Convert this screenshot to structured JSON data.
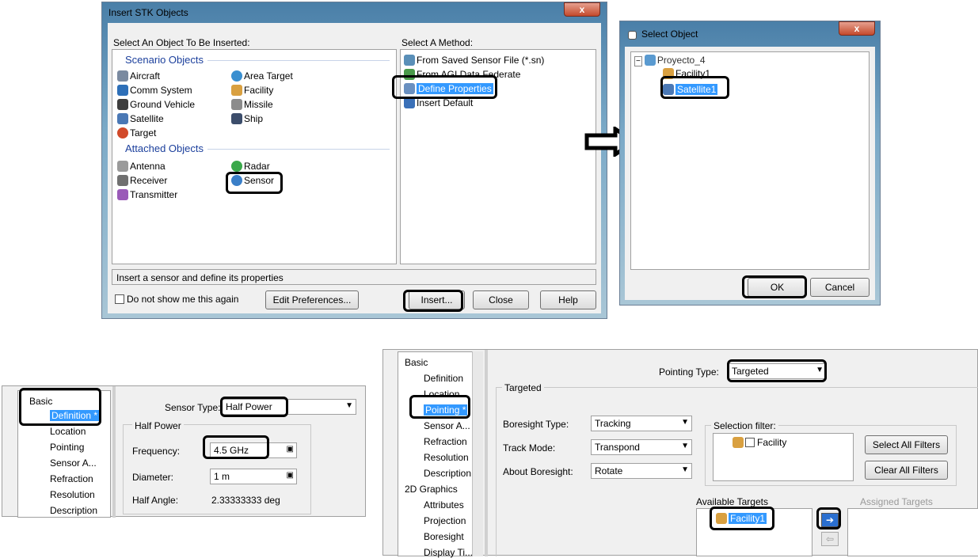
{
  "insert_dialog": {
    "title": "Insert STK Objects",
    "close": "x",
    "left_header": "Select An Object To Be Inserted:",
    "right_header": "Select A Method:",
    "scenario_header": "Scenario Objects",
    "attached_header": "Attached Objects",
    "scenario_objects": [
      "Aircraft",
      "Area Target",
      "Comm System",
      "Facility",
      "Ground Vehicle",
      "Missile",
      "Satellite",
      "Ship",
      "Target"
    ],
    "attached_objects": [
      "Antenna",
      "Radar",
      "Receiver",
      "Sensor",
      "Transmitter"
    ],
    "methods": [
      "From Saved Sensor File (*.sn)",
      "From AGI Data Federate",
      "Define Properties",
      "Insert Default"
    ],
    "status": "Insert a sensor and define its properties",
    "checkbox": "Do not show me this again",
    "edit_prefs": "Edit Preferences...",
    "insert": "Insert...",
    "close_btn": "Close",
    "help": "Help"
  },
  "select_dialog": {
    "title": "Select Object",
    "close": "x",
    "tree": [
      "Proyecto_4",
      "Facility1",
      "Satellite1"
    ],
    "ok": "OK",
    "cancel": "Cancel"
  },
  "sensor_panel": {
    "tree": [
      "Basic",
      "Definition *",
      "Location",
      "Pointing",
      "Sensor A...",
      "Refraction",
      "Resolution",
      "Description"
    ],
    "sensor_type_label": "Sensor Type:",
    "sensor_type": "Half Power",
    "group": "Half Power",
    "frequency_label": "Frequency:",
    "frequency": "4.5 GHz",
    "diameter_label": "Diameter:",
    "diameter": "1 m",
    "half_angle_label": "Half Angle:",
    "half_angle": "2.33333333 deg"
  },
  "pointing_panel": {
    "tree": [
      "Basic",
      "Definition",
      "Location",
      "Pointing *",
      "Sensor A...",
      "Refraction",
      "Resolution",
      "Description",
      "2D Graphics",
      "Attributes",
      "Projection",
      "Boresight",
      "Display Ti..."
    ],
    "pointing_type_label": "Pointing Type:",
    "pointing_type": "Targeted",
    "group": "Targeted",
    "boresight_label": "Boresight Type:",
    "boresight": "Tracking",
    "track_label": "Track Mode:",
    "track": "Transpond",
    "about_label": "About Boresight:",
    "about": "Rotate",
    "filter_label": "Selection filter:",
    "filter_item": "Facility",
    "select_all": "Select All Filters",
    "clear_all": "Clear All Filters",
    "available_label": "Available Targets",
    "available_item": "Facility1",
    "assigned_label": "Assigned Targets"
  }
}
